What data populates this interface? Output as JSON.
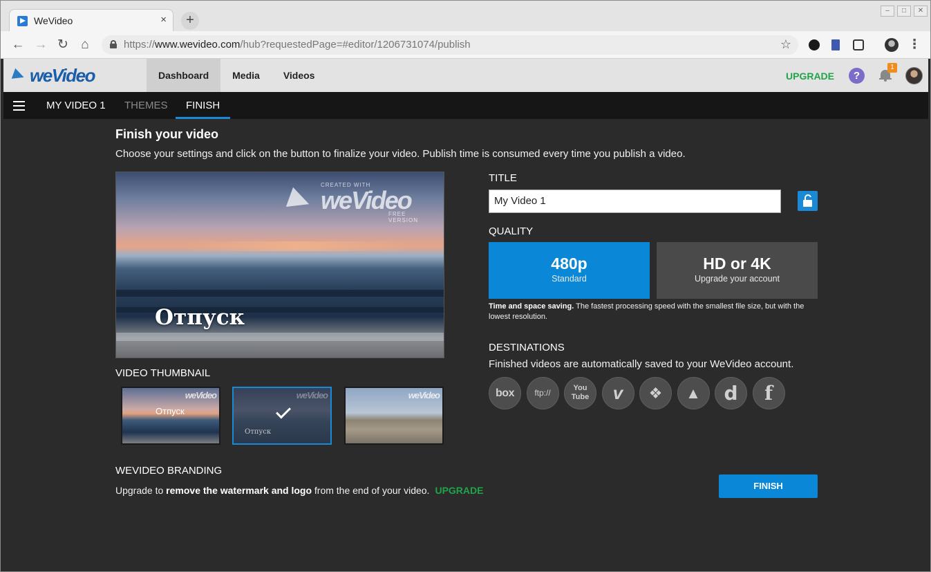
{
  "browser": {
    "tab_title": "WeVideo",
    "tab_close": "×",
    "new_tab": "+",
    "url_prefix": "https://",
    "url_host": "www.wevideo.com",
    "url_path": "/hub?requestedPage=#editor/1206731074/publish"
  },
  "header": {
    "logo": "weVideo",
    "nav": [
      "Dashboard",
      "Media",
      "Videos"
    ],
    "upgrade": "UPGRADE",
    "help": "?",
    "notification_count": "1"
  },
  "editor_tabs": [
    "MY VIDEO 1",
    "THEMES",
    "FINISH"
  ],
  "main": {
    "heading": "Finish your video",
    "subheading": "Choose your settings and click on the button to finalize your video. Publish time is consumed every time you publish a video.",
    "preview_title": "Отпуск",
    "watermark_top": "CREATED WITH",
    "watermark_logo": "weVideo",
    "watermark_sub": "FREE VERSION",
    "thumbnail_heading": "VIDEO THUMBNAIL",
    "thumbnails": [
      {
        "caption": "Отпуск",
        "watermark": "weVideo"
      },
      {
        "caption": "Отпуск",
        "watermark": "weVideo"
      },
      {
        "caption": "",
        "watermark": "weVideo"
      }
    ],
    "title_label": "TITLE",
    "title_value": "My Video 1",
    "quality_label": "QUALITY",
    "quality_options": [
      {
        "main": "480p",
        "sub": "Standard"
      },
      {
        "main": "HD or 4K",
        "sub": "Upgrade your account"
      }
    ],
    "quality_note_bold": "Time and space saving.",
    "quality_note": " The fastest processing speed with the smallest file size, but with the lowest resolution.",
    "destinations_label": "DESTINATIONS",
    "destinations_text": "Finished videos are automatically saved to your WeVideo account.",
    "destinations": [
      "box",
      "ftp://",
      "You Tube",
      "v",
      "❖",
      "▲",
      "d",
      "f"
    ],
    "branding_heading": "WEVIDEO BRANDING",
    "branding_pre": "Upgrade to ",
    "branding_bold": "remove the watermark and logo",
    "branding_post": " from the end of your video.",
    "branding_upgrade": "UPGRADE",
    "finish_button": "FINISH"
  },
  "colors": {
    "accent": "#0a87d6",
    "upgrade": "#21a34a",
    "badge": "#f08c1c"
  }
}
